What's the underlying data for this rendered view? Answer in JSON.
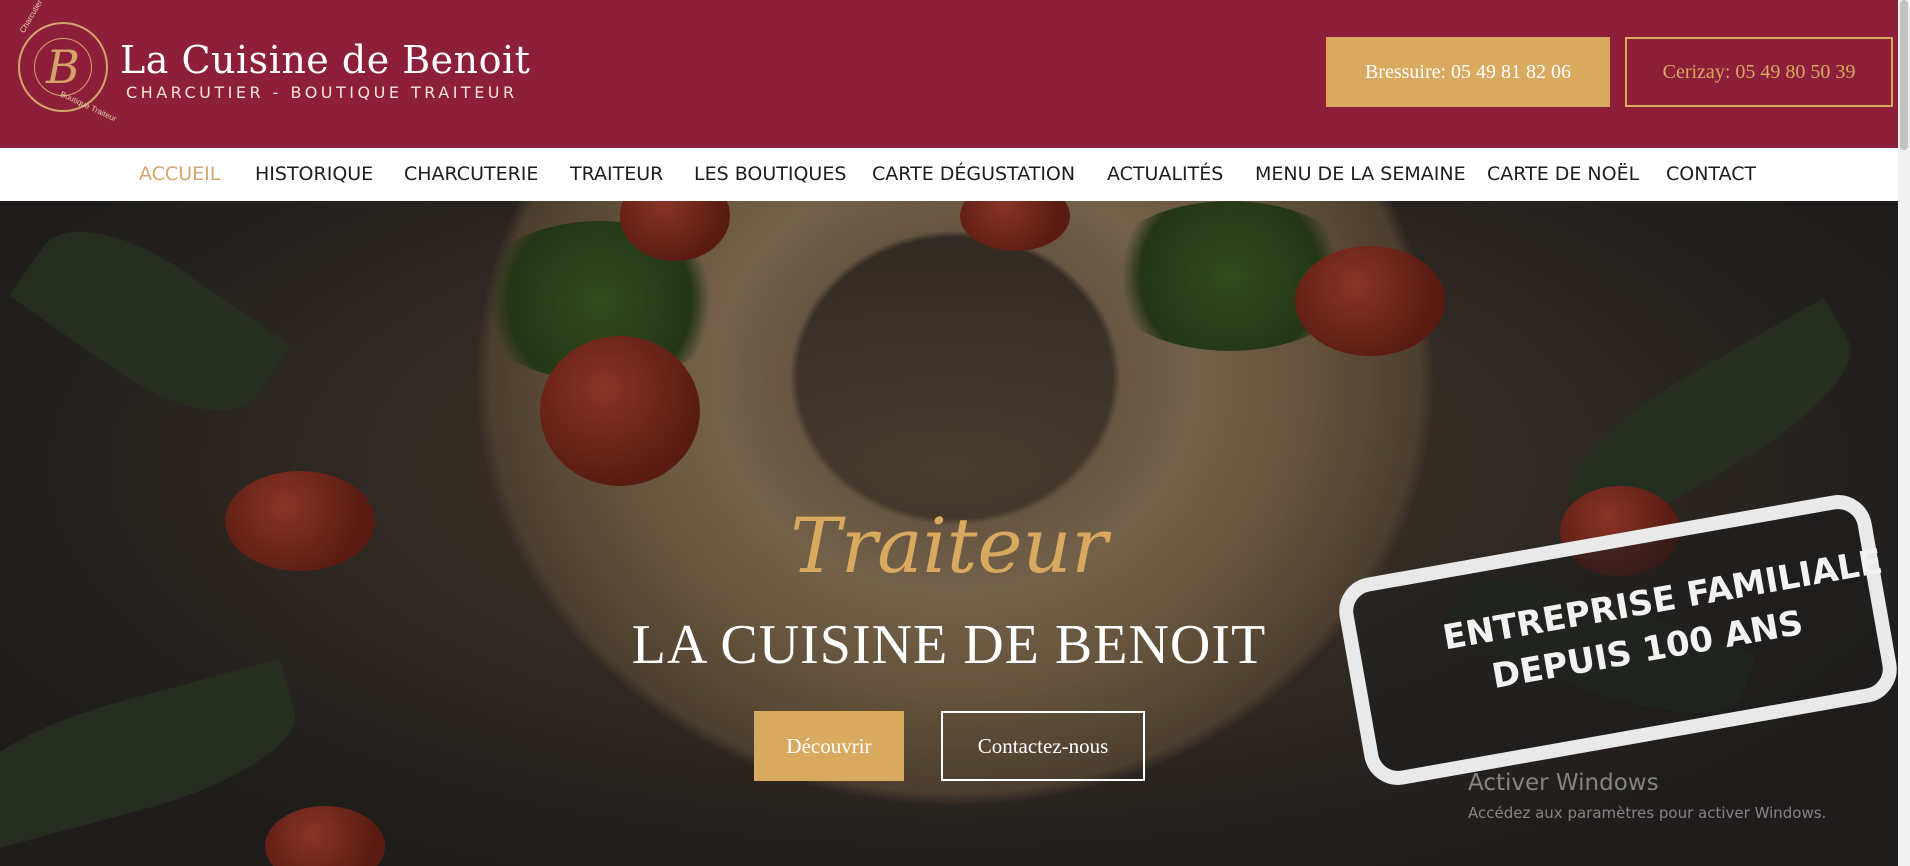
{
  "header": {
    "logo_letter": "B",
    "logo_ring_top": "Charcutier",
    "logo_ring_bottom": "Boutique Traiteur",
    "brand_name": "La Cuisine de Benoit",
    "brand_tagline": "CHARCUTIER - BOUTIQUE  TRAITEUR",
    "phone_bressuire": "Bressuire: 05 49 81 82 06",
    "phone_cerizay": "Cerizay: 05 49 80 50 39"
  },
  "nav": {
    "items": [
      {
        "label": "ACCUEIL",
        "active": true
      },
      {
        "label": "HISTORIQUE"
      },
      {
        "label": "CHARCUTERIE"
      },
      {
        "label": "TRAITEUR"
      },
      {
        "label": "LES BOUTIQUES"
      },
      {
        "label": "CARTE DÉGUSTATION"
      },
      {
        "label": "ACTUALITÉS"
      },
      {
        "label": "MENU DE LA SEMAINE"
      },
      {
        "label": "CARTE DE NOËL"
      },
      {
        "label": "CONTACT"
      }
    ]
  },
  "hero": {
    "script_title": "Traiteur",
    "title": "LA CUISINE DE BENOIT",
    "primary_button": "Découvrir",
    "secondary_button": "Contactez-nous",
    "stamp_line1": "ENTREPRISE FAMILIALE",
    "stamp_line2": "DEPUIS 100 ANS"
  },
  "windows_watermark": {
    "title": "Activer Windows",
    "subtitle": "Accédez aux paramètres pour activer Windows."
  },
  "colors": {
    "brand_burgundy": "#8d1f3a",
    "accent_gold": "#d9a95f",
    "nav_bg": "#ffffff"
  }
}
